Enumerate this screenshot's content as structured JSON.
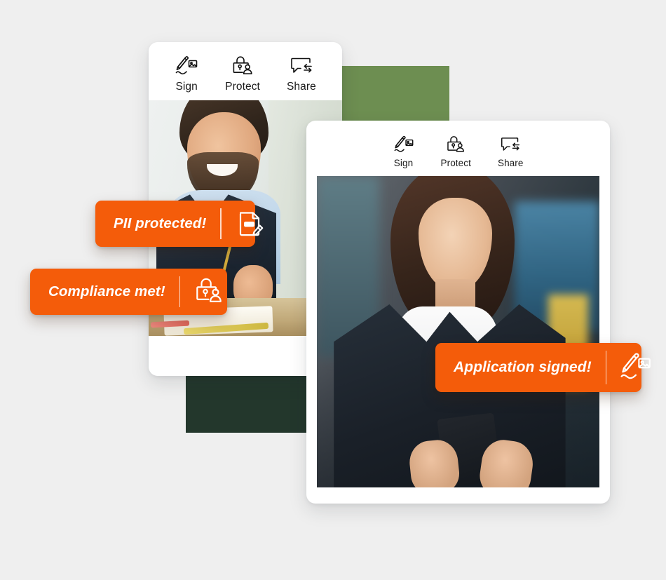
{
  "page": {
    "background_color": "#efefef",
    "accent_color": "#f45c0a",
    "green_light_color": "#6d8e51",
    "green_dark_color": "#23372c"
  },
  "decor": {
    "block_green_light_name": "green-accent-block",
    "block_green_dark_name": "dark-green-accent-block"
  },
  "card_back": {
    "toolbar": [
      {
        "icon": "sign-icon",
        "label": "Sign"
      },
      {
        "icon": "protect-icon",
        "label": "Protect"
      },
      {
        "icon": "share-icon",
        "label": "Share"
      }
    ],
    "photo_alt": "Smiling bearded man working at a desk with a monitor, holding a pencil"
  },
  "card_front": {
    "toolbar": [
      {
        "icon": "sign-icon",
        "label": "Sign"
      },
      {
        "icon": "protect-icon",
        "label": "Protect"
      },
      {
        "icon": "share-icon",
        "label": "Share"
      }
    ],
    "photo_alt": "Woman in a dark blazer looking at her smartphone"
  },
  "badges": [
    {
      "text": "PII protected!",
      "icon": "redacted-document-edit-icon"
    },
    {
      "text": "Compliance met!",
      "icon": "lock-person-icon"
    },
    {
      "text": "Application signed!",
      "icon": "sign-icon"
    }
  ]
}
